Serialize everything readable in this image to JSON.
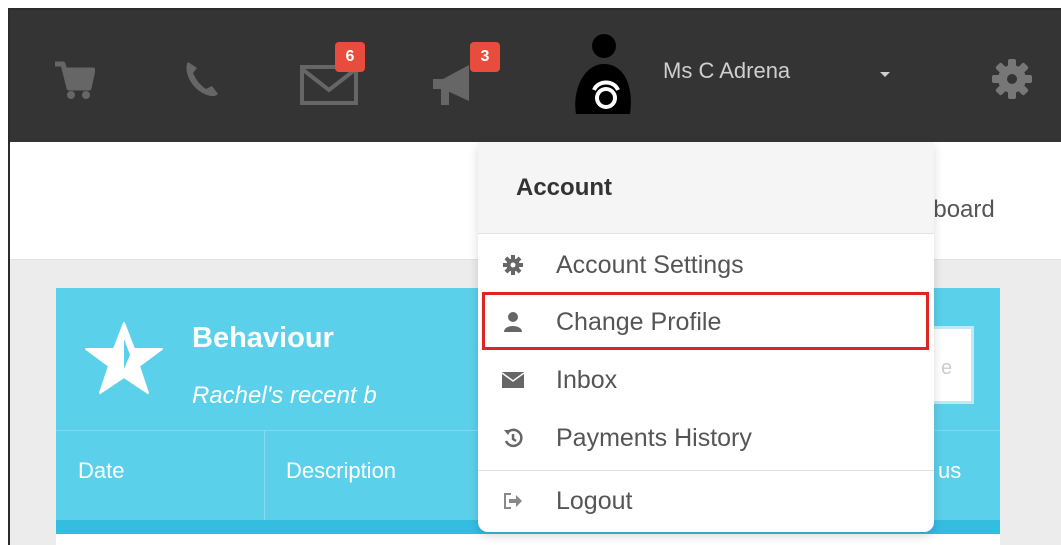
{
  "nav": {
    "messages_count": "6",
    "announcements_count": "3",
    "user_name": "Ms C Adrena"
  },
  "subbar": {
    "dashboard_partial": "nboard"
  },
  "panel": {
    "title": "Behaviour",
    "subtitle": "Rachel's recent b",
    "search_partial": "e",
    "columns": [
      "Date",
      "Description",
      "us"
    ]
  },
  "dropdown": {
    "header": "Account",
    "items": [
      {
        "label": "Account Settings",
        "icon": "gear-icon"
      },
      {
        "label": "Change Profile",
        "icon": "user-icon"
      },
      {
        "label": "Inbox",
        "icon": "envelope-icon"
      },
      {
        "label": "Payments History",
        "icon": "history-icon"
      },
      {
        "label": "Logout",
        "icon": "sign-out-icon"
      }
    ]
  },
  "colors": {
    "topbar": "#343434",
    "panel": "#5bd0ea",
    "badge": "#e74c3c",
    "highlight": "#e02424"
  }
}
